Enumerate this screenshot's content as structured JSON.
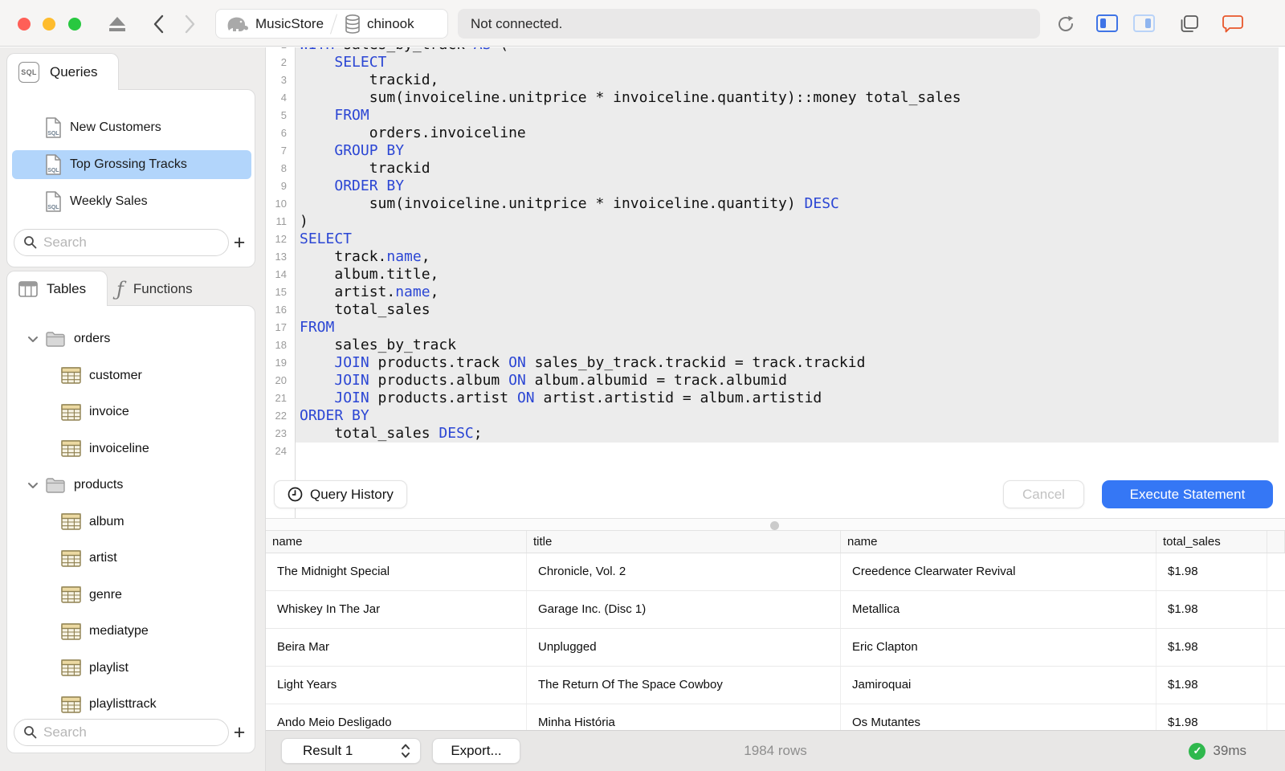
{
  "titlebar": {
    "breadcrumb": {
      "server": "MusicStore",
      "database": "chinook"
    },
    "status": "Not connected.",
    "colors": {
      "close": "#ff5f57",
      "minimize": "#febc2e",
      "zoom": "#28c840",
      "panel_active": "#3f74e6",
      "panel_inactive": "#a9c8f5",
      "bubble": "#e8562a"
    }
  },
  "sidebar": {
    "queries": {
      "tab_label": "Queries",
      "items": [
        {
          "label": "New Customers",
          "selected": false
        },
        {
          "label": "Top Grossing Tracks",
          "selected": true
        },
        {
          "label": "Weekly Sales",
          "selected": false
        }
      ],
      "search_placeholder": "Search",
      "add_label": "+",
      "selection_color": "#b2d5fb"
    },
    "tables": {
      "tab_label": "Tables",
      "functions_tab_label": "Functions",
      "tree": [
        {
          "type": "folder",
          "label": "orders",
          "expanded": true
        },
        {
          "type": "table",
          "label": "customer"
        },
        {
          "type": "table",
          "label": "invoice"
        },
        {
          "type": "table",
          "label": "invoiceline"
        },
        {
          "type": "folder",
          "label": "products",
          "expanded": true
        },
        {
          "type": "table",
          "label": "album"
        },
        {
          "type": "table",
          "label": "artist"
        },
        {
          "type": "table",
          "label": "genre"
        },
        {
          "type": "table",
          "label": "mediatype"
        },
        {
          "type": "table",
          "label": "playlist"
        },
        {
          "type": "table",
          "label": "playlisttrack"
        }
      ],
      "search_placeholder": "Search",
      "add_label": "+",
      "table_icon_colors": {
        "border": "#8f8150",
        "header": "#ecd9a2",
        "body": "#f7f3e4"
      }
    }
  },
  "editor": {
    "keyword_color": "#2b46d4",
    "statement_highlight_color": "#ececec",
    "lines": [
      {
        "n": 1,
        "hl": true,
        "segs": [
          [
            "WITH",
            1
          ],
          [
            " sales_by_track ",
            0
          ],
          [
            "AS",
            1
          ],
          [
            " (",
            0
          ]
        ]
      },
      {
        "n": 2,
        "hl": true,
        "segs": [
          [
            "    ",
            0
          ],
          [
            "SELECT",
            1
          ]
        ]
      },
      {
        "n": 3,
        "hl": true,
        "segs": [
          [
            "        trackid,",
            0
          ]
        ]
      },
      {
        "n": 4,
        "hl": true,
        "segs": [
          [
            "        sum(invoiceline.unitprice * invoiceline.quantity)::money total_sales",
            0
          ]
        ]
      },
      {
        "n": 5,
        "hl": true,
        "segs": [
          [
            "    ",
            0
          ],
          [
            "FROM",
            1
          ]
        ]
      },
      {
        "n": 6,
        "hl": true,
        "segs": [
          [
            "        orders.invoiceline",
            0
          ]
        ]
      },
      {
        "n": 7,
        "hl": true,
        "segs": [
          [
            "    ",
            0
          ],
          [
            "GROUP BY",
            1
          ]
        ]
      },
      {
        "n": 8,
        "hl": true,
        "segs": [
          [
            "        trackid",
            0
          ]
        ]
      },
      {
        "n": 9,
        "hl": true,
        "segs": [
          [
            "    ",
            0
          ],
          [
            "ORDER BY",
            1
          ]
        ]
      },
      {
        "n": 10,
        "hl": true,
        "segs": [
          [
            "        sum(invoiceline.unitprice * invoiceline.quantity) ",
            0
          ],
          [
            "DESC",
            1
          ]
        ]
      },
      {
        "n": 11,
        "hl": true,
        "segs": [
          [
            ")",
            0
          ]
        ]
      },
      {
        "n": 12,
        "hl": true,
        "segs": [
          [
            "SELECT",
            1
          ]
        ]
      },
      {
        "n": 13,
        "hl": true,
        "segs": [
          [
            "    track.",
            0
          ],
          [
            "name",
            1
          ],
          [
            ",",
            0
          ]
        ]
      },
      {
        "n": 14,
        "hl": true,
        "segs": [
          [
            "    album.title,",
            0
          ]
        ]
      },
      {
        "n": 15,
        "hl": true,
        "segs": [
          [
            "    artist.",
            0
          ],
          [
            "name",
            1
          ],
          [
            ",",
            0
          ]
        ]
      },
      {
        "n": 16,
        "hl": true,
        "segs": [
          [
            "    total_sales",
            0
          ]
        ]
      },
      {
        "n": 17,
        "hl": true,
        "segs": [
          [
            "FROM",
            1
          ]
        ]
      },
      {
        "n": 18,
        "hl": true,
        "segs": [
          [
            "    sales_by_track",
            0
          ]
        ]
      },
      {
        "n": 19,
        "hl": true,
        "segs": [
          [
            "    ",
            0
          ],
          [
            "JOIN",
            1
          ],
          [
            " products.track ",
            0
          ],
          [
            "ON",
            1
          ],
          [
            " sales_by_track.trackid = track.trackid",
            0
          ]
        ]
      },
      {
        "n": 20,
        "hl": true,
        "segs": [
          [
            "    ",
            0
          ],
          [
            "JOIN",
            1
          ],
          [
            " products.album ",
            0
          ],
          [
            "ON",
            1
          ],
          [
            " album.albumid = track.albumid",
            0
          ]
        ]
      },
      {
        "n": 21,
        "hl": true,
        "segs": [
          [
            "    ",
            0
          ],
          [
            "JOIN",
            1
          ],
          [
            " products.artist ",
            0
          ],
          [
            "ON",
            1
          ],
          [
            " artist.artistid = album.artistid",
            0
          ]
        ]
      },
      {
        "n": 22,
        "hl": true,
        "segs": [
          [
            "ORDER BY",
            1
          ]
        ]
      },
      {
        "n": 23,
        "hl": true,
        "segs": [
          [
            "    total_sales ",
            0
          ],
          [
            "DESC",
            1
          ],
          [
            ";",
            0
          ]
        ]
      },
      {
        "n": 24,
        "hl": false,
        "segs": []
      }
    ]
  },
  "toolbar": {
    "query_history_label": "Query History",
    "cancel_label": "Cancel",
    "execute_label": "Execute Statement",
    "execute_color": "#3577f5"
  },
  "results": {
    "columns": [
      "name",
      "title",
      "name",
      "total_sales"
    ],
    "rows": [
      [
        "The Midnight Special",
        "Chronicle, Vol. 2",
        "Creedence Clearwater Revival",
        "$1.98"
      ],
      [
        "Whiskey In The Jar",
        "Garage Inc. (Disc 1)",
        "Metallica",
        "$1.98"
      ],
      [
        "Beira Mar",
        "Unplugged",
        "Eric Clapton",
        "$1.98"
      ],
      [
        "Light Years",
        "The Return Of The Space Cowboy",
        "Jamiroquai",
        "$1.98"
      ],
      [
        "Ando Meio Desligado",
        "Minha História",
        "Os Mutantes",
        "$1.98"
      ]
    ]
  },
  "statusbar": {
    "result_selector_label": "Result 1",
    "export_label": "Export...",
    "row_count": "1984 rows",
    "duration": "39ms",
    "success_color": "#2fb84d"
  }
}
